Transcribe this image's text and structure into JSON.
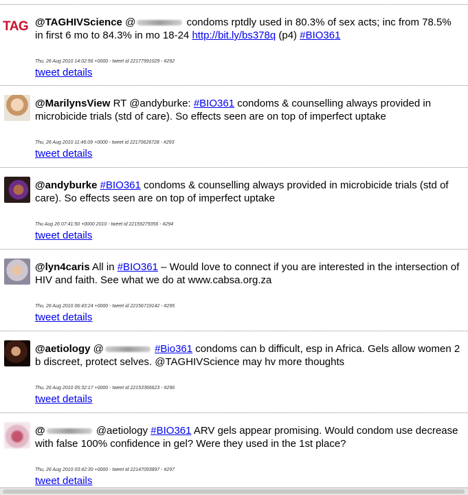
{
  "tweets": [
    {
      "user": "@TAGHIVScience",
      "avatar_text": "TAG",
      "parts": {
        "t1": "condoms rptdly used in 80.3% of sex acts; inc from 78.5% in first 6 mo to 84.3% in mo 18-24",
        "link": "http://bit.ly/bs378q",
        "t2": "(p4)",
        "hashtag": "#BIO361"
      },
      "meta": "Thu, 26 Aug 2010 14:02:56 +0000 - tweet id 22177991029 - #292",
      "details": "tweet details"
    },
    {
      "user": "@MarilynsView",
      "parts": {
        "t0": "RT @andyburke:",
        "hashtag": "#BIO361",
        "t1": "condoms & counselling always provided in microbicide trials (std of care). So effects seen are on top of imperfect uptake"
      },
      "meta": "Thu, 26 Aug 2010 11:46:09 +0000 - tweet id 22170626728 - #293",
      "details": "tweet details"
    },
    {
      "user": "@andyburke",
      "parts": {
        "hashtag": "#BIO361",
        "t1": "condoms & counselling always provided in microbicide trials (std of care). So effects seen are on top of imperfect uptake"
      },
      "meta": "Thu Aug 26 07:41:50 +0000 2010 - tweet id 22159279356 - #294",
      "details": "tweet details"
    },
    {
      "user": "@lyn4caris",
      "parts": {
        "t0": "All in",
        "hashtag": "#BIO361",
        "t1": "– Would love to connect if you are interested in the intersection of HIV and faith. See what we do at www.cabsa.org.za"
      },
      "meta": "Thu, 26 Aug 2010 06:43:24 +0000 - tweet id 22156719142 - #295",
      "details": "tweet details"
    },
    {
      "user": "@aetiology",
      "parts": {
        "t0": "@",
        "hashtag": "#Bio361",
        "t1": "condoms can b difficult, esp in Africa. Gels allow women 2 b discreet, protect selves. @TAGHIVScience may hv more thoughts"
      },
      "meta": "Thu, 26 Aug 2010 05:32:17 +0000 - tweet id 22153366623 - #296",
      "details": "tweet details"
    },
    {
      "user": "@",
      "parts": {
        "t0": "@aetiology",
        "hashtag": "#BIO361",
        "t1": "ARV gels appear promising. Would condom use decrease with false 100% confidence in gel? Were they used in the 1st place?"
      },
      "meta": "Thu, 26 Aug 2010 03:42:30 +0000 - tweet id 22147093897 - #297",
      "details": "tweet details"
    }
  ]
}
